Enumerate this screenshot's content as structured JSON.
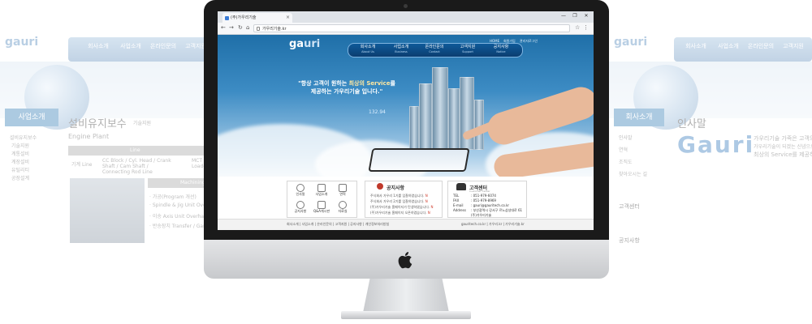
{
  "colors": {
    "accent": "#1f6fa8",
    "nav": "#0b3e70",
    "notice_number": "#d03a2b"
  },
  "background_left": {
    "logo": "gauri",
    "nav": [
      "회사소개",
      "사업소개",
      "온라인문의",
      "고객지원"
    ],
    "side_header": "사업소개",
    "side_items": [
      "설비유지보수",
      "기술지원",
      "계통설비",
      "계장설비",
      "유틸리티",
      "공장설계"
    ],
    "page_title": "설비유지보수",
    "breadcrumb": "기술지원",
    "section": "Engine Plant",
    "table_head": "Line",
    "row_label": "기계 Line",
    "row_values": [
      "CC Block / Cyl. Head / Crank Shaft / Cam Shaft / Connecting Rod Line",
      "MCT / Lathe / Loader"
    ],
    "subtitle": "Machining",
    "list": [
      "· 가공(Program 개선)",
      "· Spindle & Jig Unit Overhaul",
      "· 이송 Axis Unit Overhaul",
      "· 반송장치 Transfer / Gantry Loader"
    ]
  },
  "background_right": {
    "logo": "gauri",
    "nav": [
      "회사소개",
      "사업소개",
      "온라인문의",
      "고객지원"
    ],
    "side_header": "회사소개",
    "side_items": [
      "인사말",
      "연혁",
      "조직도",
      "찾아오시는 길"
    ],
    "page_title": "인사말",
    "big_logo": "Gauri",
    "tagline_1": "가우리기술 가족은 고객의",
    "tagline_2": "가우리기술이 되겠는 신념으로",
    "tagline_3": "최상의 Service를 제공하겠습니다",
    "contact_header": "고객센터",
    "notice_header": "공지사항"
  },
  "browser": {
    "tab_title": "(주)가우리기술",
    "tab_close": "×",
    "url": "가우리기술.kr",
    "window_buttons": [
      "—",
      "❐",
      "✕"
    ]
  },
  "site": {
    "logo_main": "ga",
    "logo_accent": "uri",
    "nav": [
      {
        "ko": "회사소개",
        "en": "About Us"
      },
      {
        "ko": "사업소개",
        "en": "Business"
      },
      {
        "ko": "온라인문의",
        "en": "Contact"
      },
      {
        "ko": "고객지원",
        "en": "Support"
      },
      {
        "ko": "공지사항",
        "en": "Notice"
      }
    ],
    "utility_links": [
      "HOME",
      "회원가입",
      "관리자로그인"
    ],
    "slogan_line1_pre": "\"항상 고객이 원하는 ",
    "slogan_line1_hl": "최상의 Service",
    "slogan_line1_post": "를",
    "slogan_line2": "제공하는 가우리기술 입니다.\"",
    "stock_value": "132.94"
  },
  "quick_menu": [
    {
      "label": "인사말",
      "icon": "globe-icon"
    },
    {
      "label": "사업소개",
      "icon": "document-icon"
    },
    {
      "label": "연혁",
      "icon": "bar-chart-icon"
    },
    {
      "label": "공지사항",
      "icon": "chat-icon"
    },
    {
      "label": "Q&A게시판",
      "icon": "board-icon"
    },
    {
      "label": "자료실",
      "icon": "target-icon"
    }
  ],
  "notice": {
    "title": "공지사항",
    "items": [
      {
        "text": "주식회사 가우리 1기를 입찰하였습니다.",
        "badge": "N"
      },
      {
        "text": "주식회사 가우리 2기를 입찰하였습니다.",
        "badge": "N"
      },
      {
        "text": "(주)가우리기술 홈페이지가 탄생하였습니다.",
        "badge": "N"
      },
      {
        "text": "(주)가우리기술 홈페이지 오픈하였습니다.",
        "badge": "N"
      }
    ]
  },
  "contact": {
    "title": "고객센터",
    "subtitle": "Customer Center",
    "rows": [
      {
        "k": "TEL",
        "v": ": 051-979-6074"
      },
      {
        "k": "FAX",
        "v": ": 051-979-8969"
      },
      {
        "k": "E-mail",
        "v": ": gauri@gauritech.co.kr"
      },
      {
        "k": "Address",
        "v": ": 부산광역시 강서구 르노삼성대로 61"
      },
      {
        "k": "",
        "v": "(주)가우리기술"
      }
    ]
  },
  "footer": {
    "links": "회사소개 | 사업소개 | 온라인문의 | 고객지원 | 공지사항 | 개인정보처리방침",
    "right": "gauritech.co.kr | 가우리.kr | 가우리기술.kr"
  }
}
